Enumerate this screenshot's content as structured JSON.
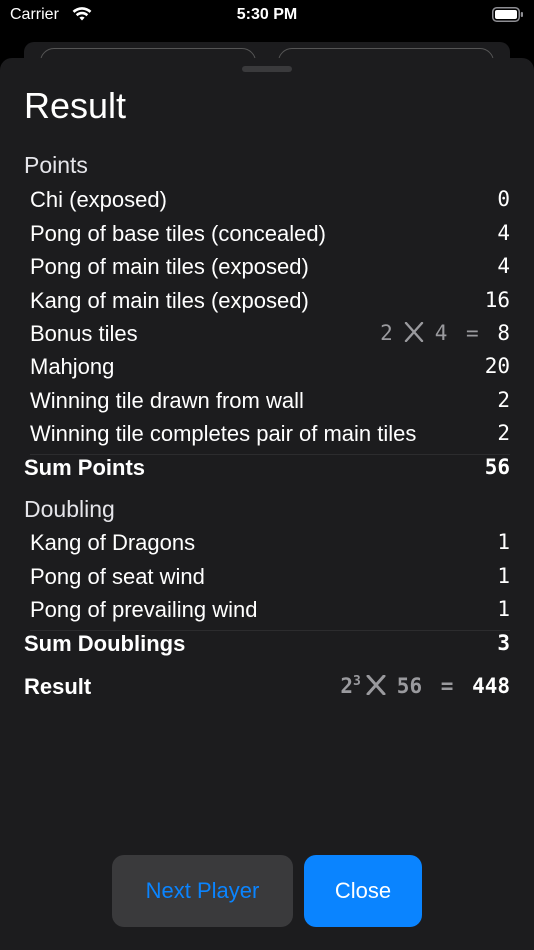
{
  "status": {
    "carrier": "Carrier",
    "time": "5:30 PM"
  },
  "title": "Result",
  "points": {
    "heading": "Points",
    "rows": [
      {
        "label": "Chi (exposed)",
        "value": "0"
      },
      {
        "label": "Pong of base tiles (concealed)",
        "value": "4"
      },
      {
        "label": "Pong of main tiles (exposed)",
        "value": "4"
      },
      {
        "label": "Kang of main tiles (exposed)",
        "value": "16"
      },
      {
        "label": "Bonus tiles",
        "count": "2",
        "each": "4",
        "eq": "=",
        "value": "8"
      },
      {
        "label": "Mahjong",
        "value": "20"
      },
      {
        "label": "Winning tile drawn from wall",
        "value": "2"
      },
      {
        "label": "Winning tile completes pair of main tiles",
        "value": "2"
      }
    ],
    "sum_label": "Sum Points",
    "sum_value": "56"
  },
  "doubling": {
    "heading": "Doubling",
    "rows": [
      {
        "label": "Kang of Dragons",
        "value": "1"
      },
      {
        "label": "Pong of seat wind",
        "value": "1"
      },
      {
        "label": "Pong of prevailing wind",
        "value": "1"
      }
    ],
    "sum_label": "Sum Doublings",
    "sum_value": "3"
  },
  "result": {
    "label": "Result",
    "base": "2",
    "exponent": "3",
    "points": "56",
    "eq": "=",
    "value": "448"
  },
  "buttons": {
    "next": "Next Player",
    "close": "Close"
  },
  "colors": {
    "accent": "#0a84ff",
    "sheet": "#1c1c1e",
    "button_secondary": "#3a3a3c"
  }
}
